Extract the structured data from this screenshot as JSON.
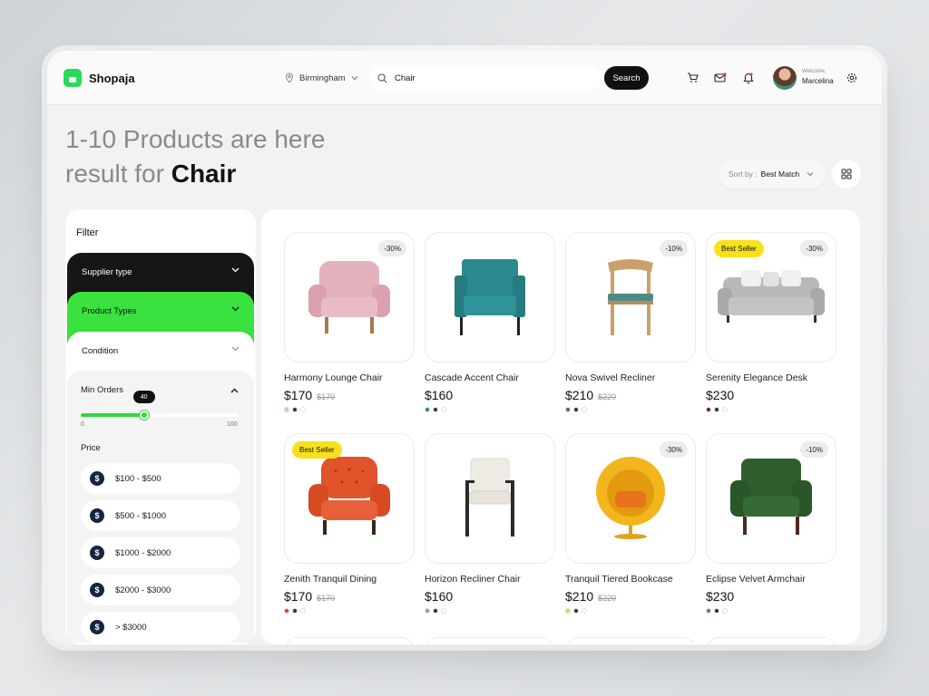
{
  "app": {
    "name": "Shopaja",
    "brand_color": "#2bd95a"
  },
  "header": {
    "location": "Birmingham",
    "search_value": "Chair",
    "search_button": "Search",
    "welcome": "Welcome,",
    "username": "Marcelina"
  },
  "title": {
    "line1": "1-10 Products are here",
    "line2_prefix": "result for",
    "query": "Chair"
  },
  "sort": {
    "label": "Sort by :",
    "value": "Best Match"
  },
  "filter": {
    "title": "Filter",
    "sections": [
      {
        "label": "Supplier type"
      },
      {
        "label": "Product Types"
      },
      {
        "label": "Condition"
      }
    ],
    "min_orders": {
      "label": "Min Orders",
      "value": 40,
      "min": "0",
      "max": "100"
    },
    "price_title": "Price",
    "price_ranges": [
      "$100 - $500",
      "$500 - $1000",
      "$1000 - $2000",
      "$2000 - $3000",
      "> $3000"
    ]
  },
  "products": [
    {
      "name": "Harmony Lounge Chair",
      "price": "$170",
      "old_price": "$170",
      "discount": "-30%",
      "best_seller": "",
      "colors": [
        "#e6b9c4",
        "#333333",
        "#ffffff"
      ],
      "image": "pink-armchair"
    },
    {
      "name": "Cascade Accent Chair",
      "price": "$160",
      "old_price": "",
      "discount": "",
      "best_seller": "",
      "colors": [
        "#2a8a8f",
        "#333333",
        "#ffffff"
      ],
      "image": "teal-chair"
    },
    {
      "name": "Nova Swivel Recliner",
      "price": "$210",
      "old_price": "$220",
      "discount": "-10%",
      "best_seller": "",
      "colors": [
        "#666666",
        "#333333",
        "#ffffff"
      ],
      "image": "wood-chair"
    },
    {
      "name": "Serenity Elegance Desk",
      "price": "$230",
      "old_price": "",
      "discount": "-30%",
      "best_seller": "Best Seller",
      "colors": [
        "#7a1f1f",
        "#333333",
        "#ffffff"
      ],
      "image": "grey-sofa"
    },
    {
      "name": "Zenith Tranquil Dining",
      "price": "$170",
      "old_price": "$170",
      "discount": "",
      "best_seller": "Best Seller",
      "colors": [
        "#e0431e",
        "#333333",
        "#ffffff"
      ],
      "image": "orange-armchair"
    },
    {
      "name": "Horizon Recliner Chair",
      "price": "$160",
      "old_price": "",
      "discount": "",
      "best_seller": "",
      "colors": [
        "#999999",
        "#333333",
        "#ffffff"
      ],
      "image": "white-chair"
    },
    {
      "name": "Tranquil Tiered Bookcase",
      "price": "$210",
      "old_price": "$220",
      "discount": "-30%",
      "best_seller": "",
      "colors": [
        "#f2d12a",
        "#333333",
        "#ffffff"
      ],
      "image": "egg-chair"
    },
    {
      "name": "Eclipse Velvet Armchair",
      "price": "$230",
      "old_price": "",
      "discount": "-10%",
      "best_seller": "",
      "colors": [
        "#6b7d3a",
        "#333333",
        "#ffffff"
      ],
      "image": "green-armchair"
    }
  ]
}
